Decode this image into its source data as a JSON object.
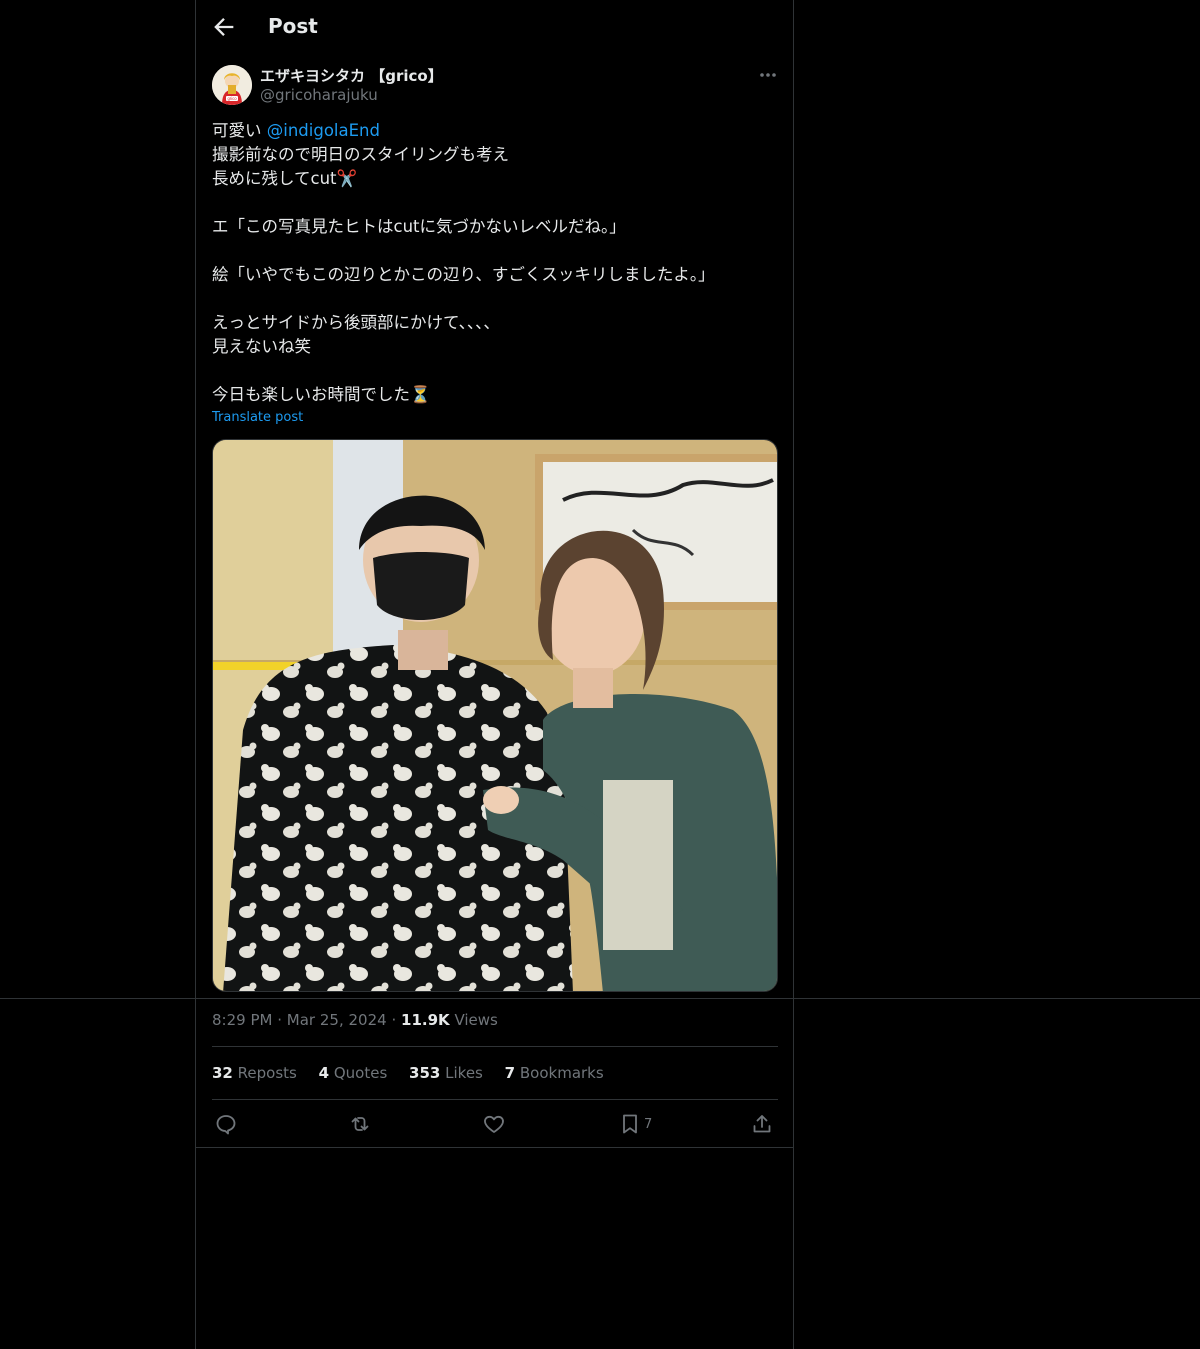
{
  "header": {
    "title": "Post"
  },
  "author": {
    "name": "エザキヨシタカ 【grico】",
    "handle": "@gricoharajuku",
    "avatar_badge": "grico"
  },
  "post": {
    "line1_prefix": "可愛い ",
    "mention": "@indigolaEnd",
    "line2": "撮影前なので明日のスタイリングも考え",
    "line3": "長めに残してcut✂️",
    "line4": "",
    "line5": "エ「この写真見たヒトはcutに気づかないレベルだね。」",
    "line6": "",
    "line7": "絵「いやでもこの辺りとかこの辺り、すごくスッキリしましたよ。」",
    "line8": "",
    "line9": "えっとサイドから後頭部にかけて、、、、",
    "line10": "見えないね笑",
    "line11": "",
    "line12": "今日も楽しいお時間でした⏳",
    "translate": "Translate post"
  },
  "meta": {
    "time": "8:29 PM",
    "dot": "·",
    "date": "Mar 25, 2024",
    "views_count": "11.9K",
    "views_label": "Views"
  },
  "stats": {
    "reposts_count": "32",
    "reposts_label": "Reposts",
    "quotes_count": "4",
    "quotes_label": "Quotes",
    "likes_count": "353",
    "likes_label": "Likes",
    "bookmarks_count": "7",
    "bookmarks_label": "Bookmarks"
  },
  "actions": {
    "bookmark_count": "7"
  },
  "icons": [
    "back-arrow-icon",
    "more-icon",
    "reply-icon",
    "repost-icon",
    "like-icon",
    "bookmark-icon",
    "share-icon"
  ],
  "colors": {
    "background": "#000000",
    "accent": "#1d9bf0",
    "muted": "#71767b",
    "border": "#2f3336"
  }
}
